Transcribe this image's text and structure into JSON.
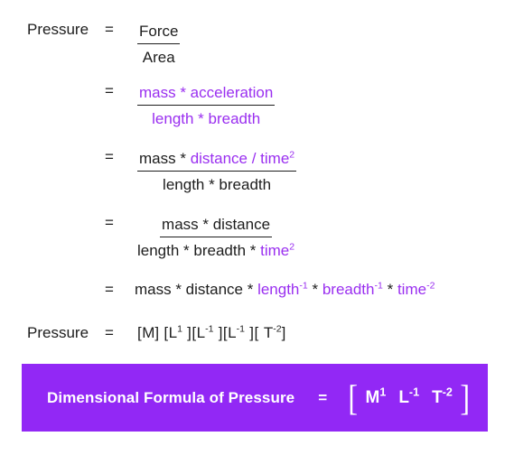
{
  "document": {
    "title": "Dimensional Formula of Pressure derivation",
    "quantity_label": "Pressure",
    "equals_sign": "=",
    "colors": {
      "accent_purple": "#9228f5",
      "text_purple": "#9a2ff0",
      "text_black": "#1d1d1d",
      "background": "#ffffff",
      "banner_text": "#ffffff"
    }
  },
  "steps": [
    {
      "label": "Pressure",
      "equals": "=",
      "type": "fraction",
      "numerator": [
        {
          "text": "Force",
          "color": "black"
        }
      ],
      "denominator": [
        {
          "text": "Area",
          "color": "black"
        }
      ]
    },
    {
      "label": "",
      "equals": "=",
      "type": "fraction",
      "numerator": [
        {
          "text": "mass  * acceleration",
          "color": "purple"
        }
      ],
      "denominator": [
        {
          "text": "length * breadth",
          "color": "purple"
        }
      ]
    },
    {
      "label": "",
      "equals": "=",
      "type": "fraction",
      "numerator": [
        {
          "text": "mass  * ",
          "color": "black"
        },
        {
          "text": "distance / time",
          "color": "purple",
          "sup": "2"
        }
      ],
      "denominator": [
        {
          "text": "length * breadth",
          "color": "black"
        }
      ]
    },
    {
      "label": "",
      "equals": "=",
      "type": "fraction",
      "numerator": [
        {
          "text": "mass * distance",
          "color": "black"
        }
      ],
      "denominator": [
        {
          "text": "length * breadth * ",
          "color": "black"
        },
        {
          "text": "time",
          "color": "purple",
          "sup": "2"
        }
      ]
    },
    {
      "label": "",
      "equals": "=",
      "type": "inline",
      "parts": [
        {
          "text": "mass * distance * ",
          "color": "black"
        },
        {
          "text": "length",
          "color": "purple",
          "sup": "-1"
        },
        {
          "text": " * ",
          "color": "black"
        },
        {
          "text": "breadth",
          "color": "purple",
          "sup": "-1"
        },
        {
          "text": " * ",
          "color": "black"
        },
        {
          "text": "time",
          "color": "purple",
          "sup": "-2"
        }
      ]
    }
  ],
  "dimension_line": {
    "label": "Pressure",
    "equals": "=",
    "terms": [
      {
        "open": "[",
        "symbol": "M",
        "sup": "",
        "close": "]"
      },
      {
        "open": "[",
        "symbol": "L",
        "sup": "1",
        "close": " ]"
      },
      {
        "open": "[",
        "symbol": "L",
        "sup": "-1",
        "close": " ]"
      },
      {
        "open": "[",
        "symbol": "L",
        "sup": "-1",
        "close": " ]"
      },
      {
        "open": "[ ",
        "symbol": "T",
        "sup": "-2",
        "close": "]"
      }
    ],
    "plain_text": "[M] [L1 ] [L-1 ] [L-1 ] [ T-2]"
  },
  "banner": {
    "title": "Dimensional Formula of Pressure",
    "equals": "=",
    "bracket_open": "[",
    "bracket_close": "]",
    "terms": [
      {
        "symbol": "M",
        "exponent": "1"
      },
      {
        "symbol": "L",
        "exponent": "-1"
      },
      {
        "symbol": "T",
        "exponent": "-2"
      }
    ],
    "formula_plain": "[ M1 L-1 T-2 ]"
  }
}
